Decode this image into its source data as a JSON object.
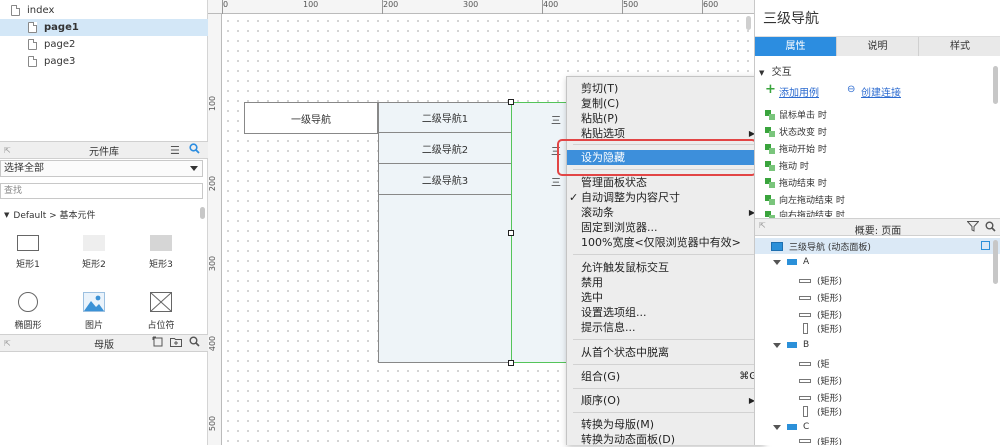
{
  "pages": [
    {
      "label": "index"
    },
    {
      "label": "page1"
    },
    {
      "label": "page2"
    },
    {
      "label": "page3"
    }
  ],
  "library": {
    "title": "元件库",
    "select_value": "选择全部",
    "search_placeholder": "查找",
    "group": "Default > 基本元件",
    "widgets": [
      "矩形1",
      "矩形2",
      "矩形3",
      "椭圆形",
      "图片",
      "占位符"
    ]
  },
  "masters": {
    "title": "母版"
  },
  "ruler": {
    "top": [
      "0",
      "100",
      "200",
      "300",
      "400",
      "500",
      "600"
    ],
    "left": [
      "100",
      "200",
      "300",
      "400",
      "500"
    ]
  },
  "canvas": {
    "nav1": "一级导航",
    "nav2": [
      "二级导航1",
      "二级导航2",
      "二级导航3"
    ],
    "nav3": [
      "三",
      "三",
      "三"
    ]
  },
  "context_menu": {
    "items": [
      {
        "label": "剪切(T)"
      },
      {
        "label": "复制(C)"
      },
      {
        "label": "粘贴(P)"
      },
      {
        "label": "粘贴选项",
        "submenu": "▶"
      },
      {
        "label": "设为隐藏"
      },
      {
        "label": "管理面板状态"
      },
      {
        "label": "自动调整为内容尺寸",
        "check": "✓"
      },
      {
        "label": "滚动条",
        "submenu": "▶"
      },
      {
        "label": "固定到浏览器..."
      },
      {
        "label": "100%宽度<仅限浏览器中有效>"
      },
      {
        "label": "允许触发鼠标交互"
      },
      {
        "label": "禁用"
      },
      {
        "label": "选中"
      },
      {
        "label": "设置选项组..."
      },
      {
        "label": "提示信息..."
      },
      {
        "label": "从首个状态中脱离"
      },
      {
        "label": "组合(G)",
        "shortcut": "⌘G"
      },
      {
        "label": "顺序(O)",
        "submenu": "▶"
      },
      {
        "label": "转换为母版(M)"
      },
      {
        "label": "转换为动态面板(D)"
      }
    ]
  },
  "inspector": {
    "title": "三级导航",
    "tabs": [
      "属性",
      "说明",
      "样式"
    ],
    "interaction_header": "交互",
    "add_case": "添加用例",
    "create_link": "创建连接",
    "events": [
      "鼠标单击 时",
      "状态改变 时",
      "拖动开始 时",
      "拖动 时",
      "拖动结束 时",
      "向左拖动结束 时",
      "向右拖动结束 时"
    ]
  },
  "outline": {
    "title": "概要: 页面",
    "root": "三级导航 (动态面板)",
    "groups": [
      "A",
      "B",
      "C"
    ],
    "rect_label": "(矩形)",
    "rect_partial": "(矩"
  },
  "colors": {
    "accent": "#2c8de0",
    "menu_highlight": "#3d8fdb",
    "callout": "#e24545",
    "selection": "#54c45a"
  }
}
